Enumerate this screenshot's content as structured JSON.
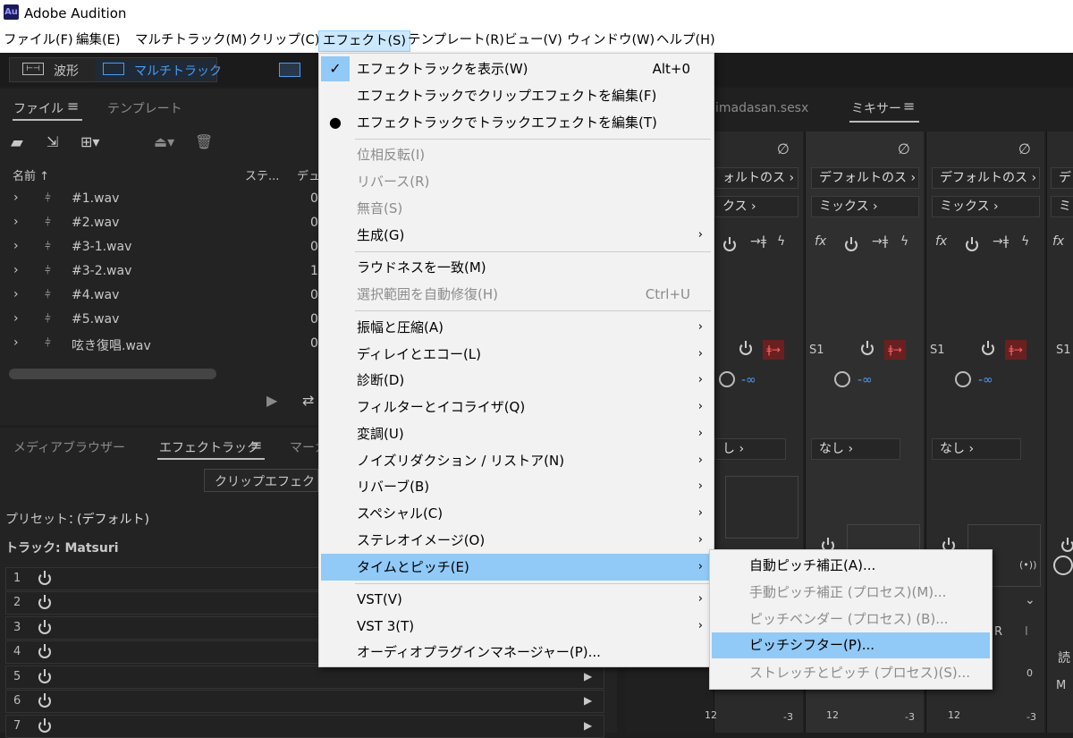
{
  "titlebar": {
    "logo": "Au",
    "title": "Adobe Audition"
  },
  "menubar": [
    "ファイル(F)",
    "編集(E)",
    "マルチトラック(M)",
    "クリップ(C)",
    "エフェクト(S)",
    "テンプレート(R)",
    "ビュー(V)",
    "ウィンドウ(W)",
    "ヘルプ(H)"
  ],
  "workspace": {
    "waveform": "波形",
    "multitrack": "マルチトラック"
  },
  "files_panel": {
    "tab_files": "ファイル",
    "tab_template": "テンプレート",
    "col_name": "名前",
    "col_status": "ステ...",
    "col_duration": "デュ",
    "files": [
      {
        "name": "#1.wav",
        "d": "0"
      },
      {
        "name": "#2.wav",
        "d": "0"
      },
      {
        "name": "#3-1.wav",
        "d": "0"
      },
      {
        "name": "#3-2.wav",
        "d": "1"
      },
      {
        "name": "#4.wav",
        "d": "0"
      },
      {
        "name": "#5.wav",
        "d": "0"
      },
      {
        "name": "呟き復唱.wav",
        "d": "0"
      }
    ]
  },
  "effects_panel": {
    "tab_media": "メディアブラウザー",
    "tab_effects": "エフェクトラック",
    "tab_marker": "マーカ",
    "clip_effect": "クリップエフェクト",
    "preset_label": "プリセット：",
    "preset_value": "(デフォルト)",
    "track_label": "トラック: Matsuri",
    "rows": [
      "1",
      "2",
      "3",
      "4",
      "5",
      "6",
      "7"
    ]
  },
  "mixer": {
    "session_tab": "imadasan.sesx",
    "mixer_tab": "ミキサー",
    "strips": [
      {
        "input": "ォルトのス",
        "output": "クス",
        "send": "",
        "vol": "-∞",
        "route": "し"
      },
      {
        "input": "デフォルトのス",
        "output": "ミックス",
        "send": "S1",
        "vol": "-∞",
        "route": "なし"
      },
      {
        "input": "デフォルトのス",
        "output": "ミックス",
        "send": "S1",
        "vol": "-∞",
        "route": "なし"
      },
      {
        "input": "デ",
        "output": "ミ",
        "send": "S1",
        "vol": "",
        "route": ""
      }
    ],
    "meter_labels": [
      "0",
      "12",
      "-3",
      "12",
      "-3",
      "12",
      "-3"
    ],
    "read_label": "読",
    "r_btn": "R",
    "i_btn": "I",
    "m_btn": "M"
  },
  "effects_menu": [
    {
      "label": "エフェクトラックを表示(W)",
      "shortcut": "Alt+0",
      "check": "✓"
    },
    {
      "label": "エフェクトラックでクリップエフェクトを編集(F)"
    },
    {
      "label": "エフェクトラックでトラックエフェクトを編集(T)",
      "check": "●"
    },
    {
      "label": "位相反転(I)",
      "disabled": true
    },
    {
      "label": "リバース(R)",
      "disabled": true
    },
    {
      "label": "無音(S)",
      "disabled": true
    },
    {
      "label": "生成(G)",
      "sub": true
    },
    {
      "label": "ラウドネスを一致(M)"
    },
    {
      "label": "選択範囲を自動修復(H)",
      "shortcut": "Ctrl+U",
      "disabled": true
    },
    {
      "label": "振幅と圧縮(A)",
      "sub": true
    },
    {
      "label": "ディレイとエコー(L)",
      "sub": true
    },
    {
      "label": "診断(D)",
      "sub": true
    },
    {
      "label": "フィルターとイコライザ(Q)",
      "sub": true
    },
    {
      "label": "変調(U)",
      "sub": true
    },
    {
      "label": "ノイズリダクション / リストア(N)",
      "sub": true
    },
    {
      "label": "リバーブ(B)",
      "sub": true
    },
    {
      "label": "スペシャル(C)",
      "sub": true
    },
    {
      "label": "ステレオイメージ(O)",
      "sub": true
    },
    {
      "label": "タイムとピッチ(E)",
      "sub": true,
      "highlight": true
    },
    {
      "label": "VST(V)",
      "sub": true
    },
    {
      "label": "VST 3(T)",
      "sub": true
    },
    {
      "label": "オーディオプラグインマネージャー(P)..."
    }
  ],
  "submenu": [
    {
      "label": "自動ピッチ補正(A)..."
    },
    {
      "label": "手動ピッチ補正 (プロセス)(M)...",
      "disabled": true
    },
    {
      "label": "ピッチベンダー (プロセス) (B)...",
      "disabled": true
    },
    {
      "label": "ピッチシフター(P)...",
      "highlight": true
    },
    {
      "label": "ストレッチとピッチ (プロセス)(S)...",
      "disabled": true
    }
  ]
}
